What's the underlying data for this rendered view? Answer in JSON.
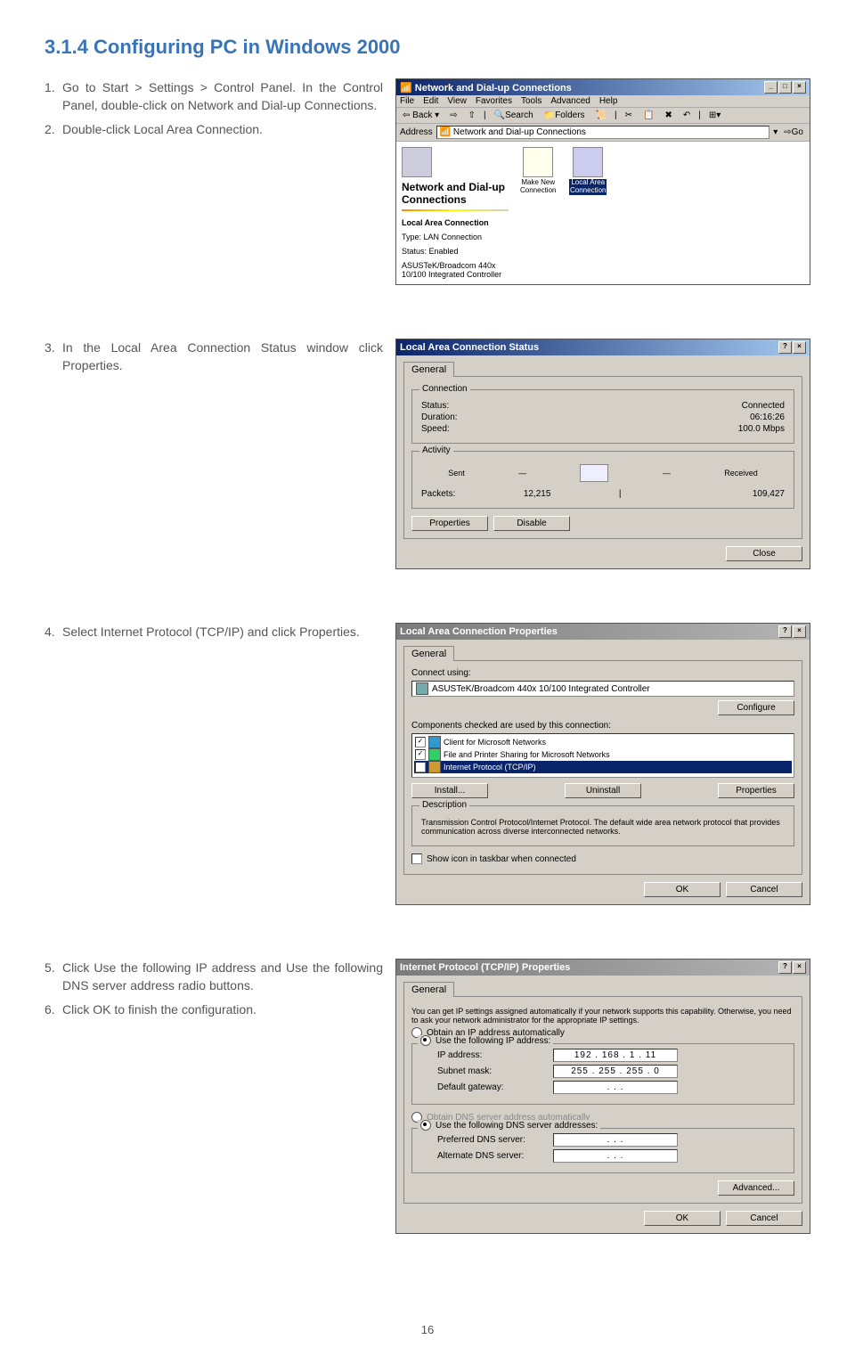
{
  "heading": "3.1.4  Configuring PC in Windows 2000",
  "steps": {
    "s1": "Go to Start > Settings > Control Panel. In the Control Panel, double-click on Network and Dial-up Connections.",
    "s2": "Double-click Local Area Connection.",
    "s3": "In the Local Area Connection Status window click Properties.",
    "s4": "Select Internet Protocol (TCP/IP) and click Properties.",
    "s5": "Click Use the following IP address and Use the following DNS server address radio buttons.",
    "s6": "Click OK to finish the configuration."
  },
  "page_number": "16",
  "win1": {
    "title": "Network and Dial-up Connections",
    "menu": [
      "File",
      "Edit",
      "View",
      "Favorites",
      "Tools",
      "Advanced",
      "Help"
    ],
    "back": "Back",
    "search": "Search",
    "folders": "Folders",
    "address_label": "Address",
    "address_value": "Network and Dial-up Connections",
    "go": "Go",
    "left_title": "Network and Dial-up Connections",
    "info_name": "Local Area Connection",
    "info_type": "Type: LAN Connection",
    "info_status": "Status: Enabled",
    "info_adapter": "ASUSTeK/Broadcom 440x 10/100 Integrated Controller",
    "icon1": "Make New Connection",
    "icon2": "Local Area Connection"
  },
  "dlg2": {
    "title": "Local Area Connection Status",
    "tab": "General",
    "grp_conn": "Connection",
    "status_l": "Status:",
    "status_v": "Connected",
    "dur_l": "Duration:",
    "dur_v": "06:16:26",
    "speed_l": "Speed:",
    "speed_v": "100.0 Mbps",
    "grp_act": "Activity",
    "sent": "Sent",
    "recv": "Received",
    "pkt_l": "Packets:",
    "pkt_sent": "12,215",
    "pkt_recv": "109,427",
    "btn_props": "Properties",
    "btn_disable": "Disable",
    "btn_close": "Close"
  },
  "dlg3": {
    "title": "Local Area Connection Properties",
    "tab": "General",
    "connect_using": "Connect using:",
    "adapter": "ASUSTeK/Broadcom 440x 10/100 Integrated Controller",
    "btn_configure": "Configure",
    "components_label": "Components checked are used by this connection:",
    "comp1": "Client for Microsoft Networks",
    "comp2": "File and Printer Sharing for Microsoft Networks",
    "comp3": "Internet Protocol (TCP/IP)",
    "btn_install": "Install...",
    "btn_uninstall": "Uninstall",
    "btn_props": "Properties",
    "desc_title": "Description",
    "desc_text": "Transmission Control Protocol/Internet Protocol. The default wide area network protocol that provides communication across diverse interconnected networks.",
    "show_icon": "Show icon in taskbar when connected",
    "btn_ok": "OK",
    "btn_cancel": "Cancel"
  },
  "dlg4": {
    "title": "Internet Protocol (TCP/IP) Properties",
    "tab": "General",
    "intro": "You can get IP settings assigned automatically if your network supports this capability. Otherwise, you need to ask your network administrator for the appropriate IP settings.",
    "r_auto_ip": "Obtain an IP address automatically",
    "r_use_ip": "Use the following IP address:",
    "ip_l": "IP address:",
    "ip_v": "192 . 168 .  1  .  11",
    "mask_l": "Subnet mask:",
    "mask_v": "255 . 255 . 255 .  0",
    "gw_l": "Default gateway:",
    "gw_v": " .       .       . ",
    "r_auto_dns": "Obtain DNS server address automatically",
    "r_use_dns": "Use the following DNS server addresses:",
    "dns1_l": "Preferred DNS server:",
    "dns1_v": " .       .       . ",
    "dns2_l": "Alternate DNS server:",
    "dns2_v": " .       .       . ",
    "btn_adv": "Advanced...",
    "btn_ok": "OK",
    "btn_cancel": "Cancel"
  }
}
